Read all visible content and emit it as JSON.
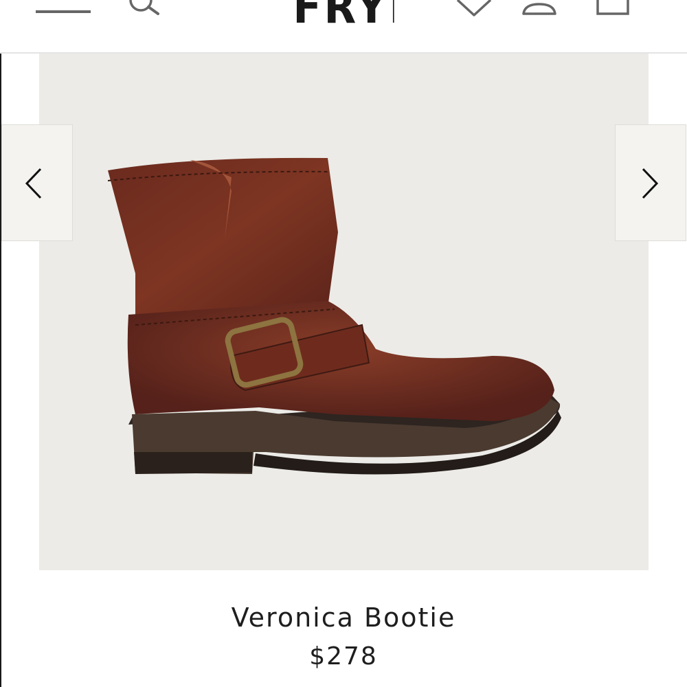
{
  "header": {
    "logo_text": "FRYE",
    "icons": [
      "menu-icon",
      "search-icon",
      "wishlist-heart-icon",
      "account-icon",
      "shopping-bag-icon"
    ]
  },
  "gallery": {
    "image_subject": "boot-icon",
    "prev_icon": "chevron-left-icon",
    "next_icon": "chevron-right-icon",
    "background_color": "#ecebe7"
  },
  "product": {
    "name": "Veronica Bootie",
    "price": "$278"
  },
  "colors": {
    "leather": "#6e2a1d",
    "sole": "#3a2a22",
    "text": "#1e1e1e"
  }
}
